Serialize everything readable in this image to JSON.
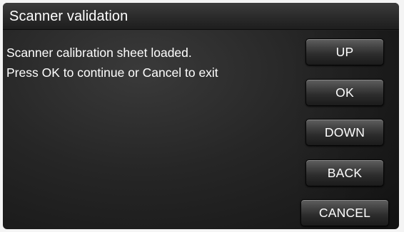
{
  "title": "Scanner validation",
  "message": {
    "line1": "Scanner calibration sheet loaded.",
    "line2": "Press OK to continue or Cancel to exit"
  },
  "buttons": {
    "up": "UP",
    "ok": "OK",
    "down": "DOWN",
    "back": "BACK",
    "cancel": "CANCEL"
  }
}
